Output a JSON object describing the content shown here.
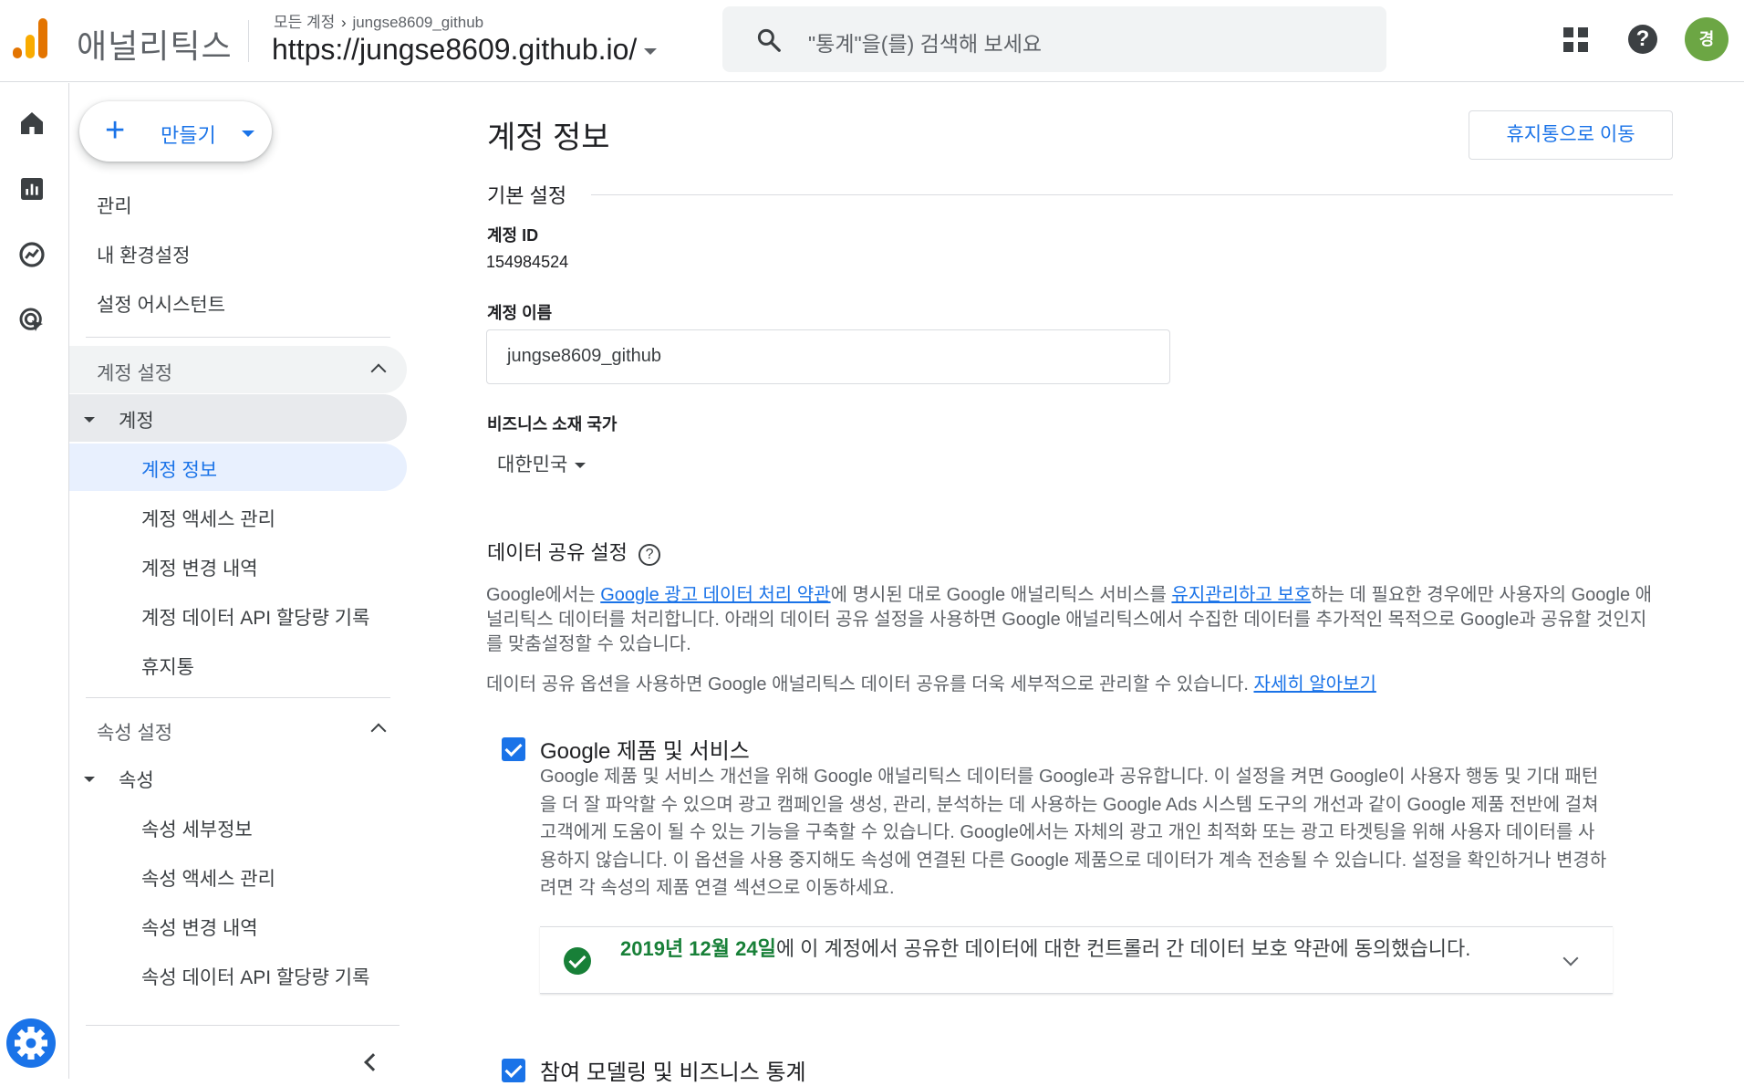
{
  "app": {
    "name": "애널리틱스"
  },
  "header": {
    "breadcrumb_all": "모든 계정",
    "breadcrumb_account": "jungse8609_github",
    "property": "https://jungse8609.github.io/",
    "search_placeholder": "\"통계\"을(를) 검색해 보세요",
    "avatar_initial": "경",
    "help_glyph": "?"
  },
  "rail": {
    "icons": [
      "home-icon",
      "reports-icon",
      "explore-icon",
      "advertising-icon",
      "admin-gear-icon"
    ]
  },
  "nav": {
    "create_label": "만들기",
    "items_top": [
      "관리",
      "내 환경설정",
      "설정 어시스턴트"
    ],
    "account_settings": {
      "title": "계정 설정",
      "group": "계정",
      "items": [
        "계정 정보",
        "계정 액세스 관리",
        "계정 변경 내역",
        "계정 데이터 API 할당량 기록",
        "휴지통"
      ]
    },
    "property_settings": {
      "title": "속성 설정",
      "group": "속성",
      "items": [
        "속성 세부정보",
        "속성 액세스 관리",
        "속성 변경 내역",
        "속성 데이터 API 할당량 기록"
      ]
    }
  },
  "main": {
    "title": "계정 정보",
    "trash_button": "휴지통으로 이동",
    "basic_section": "기본 설정",
    "account_id_label": "계정 ID",
    "account_id": "154984524",
    "account_name_label": "계정 이름",
    "account_name": "jungse8609_github",
    "country_label": "비즈니스 소재 국가",
    "country": "대한민국",
    "sharing_title": "데이터 공유 설정",
    "sharing_p1_a": "Google에서는 ",
    "sharing_p1_link1": "Google 광고 데이터 처리 약관",
    "sharing_p1_b": "에 명시된 대로 Google 애널리틱스 서비스를 ",
    "sharing_p1_link2": "유지관리하고 보호",
    "sharing_p1_c": "하는 데 필요한 경우에만 사용자의 Google 애널리틱스 데이터를 처리합니다. 아래의 데이터 공유 설정을 사용하면 Google 애널리틱스에서 수집한 데이터를 추가적인 목적으로 Google과 공유할 것인지를 맞춤설정할 수 있습니다.",
    "sharing_p2": "데이터 공유 옵션을 사용하면 Google 애널리틱스 데이터 공유를 더욱 세부적으로 관리할 수 있습니다. ",
    "sharing_p2_link": "자세히 알아보기",
    "option1_title": "Google 제품 및 서비스",
    "option1_desc": "Google 제품 및 서비스 개선을 위해 Google 애널리틱스 데이터를 Google과 공유합니다. 이 설정을 켜면 Google이 사용자 행동 및 기대 패턴을 더 잘 파악할 수 있으며 광고 캠페인을 생성, 관리, 분석하는 데 사용하는 Google Ads 시스템 도구의 개선과 같이 Google 제품 전반에 걸쳐 고객에게 도움이 될 수 있는 기능을 구축할 수 있습니다. Google에서는 자체의 광고 개인 최적화 또는 광고 타겟팅을 위해 사용자 데이터를 사용하지 않습니다. 이 옵션을 사용 중지해도 속성에 연결된 다른 Google 제품으로 데이터가 계속 전송될 수 있습니다. 설정을 확인하거나 변경하려면 각 속성의 제품 연결 섹션으로 이동하세요.",
    "consent_date": "2019년 12월 24일",
    "consent_text": "에 이 계정에서 공유한 데이터에 대한 컨트롤러 간 데이터 보호 약관에 동의했습니다.",
    "option2_title": "참여 모델링 및 비즈니스 통계"
  },
  "colors": {
    "accent": "#1a73e8",
    "selected_bg": "#e8f0fe",
    "group_bg": "#e8eaed",
    "success": "#188038",
    "avatar": "#6ca644"
  }
}
